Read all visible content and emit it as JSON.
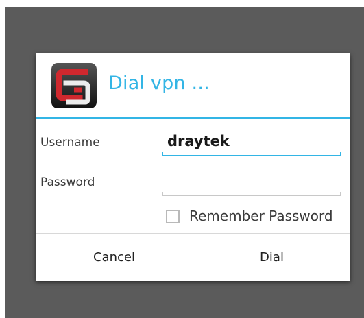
{
  "dialog": {
    "title": "Dial vpn ...",
    "icon": "smart-vpn-client-app-icon"
  },
  "form": {
    "username_label": "Username",
    "username_value": "draytek",
    "password_label": "Password",
    "password_value": "",
    "remember_label": "Remember Password",
    "remember_checked": false
  },
  "buttons": {
    "cancel_label": "Cancel",
    "dial_label": "Dial"
  },
  "colors": {
    "accent": "#33b5e5",
    "backdrop": "#5b5b5b",
    "icon_red": "#d0282e"
  }
}
